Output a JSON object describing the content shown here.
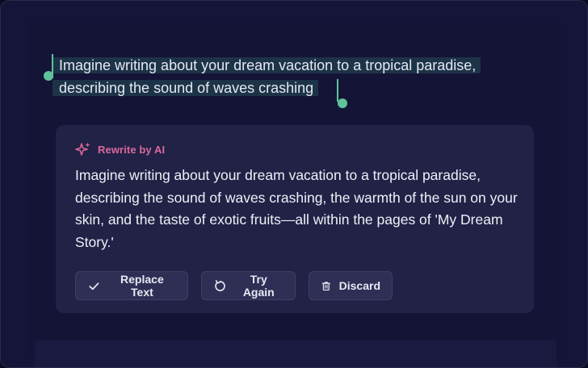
{
  "selection": {
    "lines": [
      "Imagine writing about your dream vacation to a tropical paradise,",
      "describing the sound of waves crashing"
    ]
  },
  "ai_panel": {
    "title": "Rewrite by AI",
    "body": "Imagine writing about your dream vacation to a tropical paradise, describing the sound of waves crashing, the warmth of the sun on your skin, and the taste of exotic fruits—all within the pages of 'My Dream Story.'",
    "actions": {
      "replace_label": "Replace Text",
      "retry_label": "Try Again",
      "discard_label": "Discard"
    }
  },
  "colors": {
    "accent_pink": "#d86a9b",
    "handle_green": "#5ec39a",
    "selection_bg": "#1d3348"
  },
  "icons": {
    "header": "sparkle-icon",
    "replace": "check-icon",
    "retry": "rotate-icon",
    "discard": "trash-icon"
  }
}
